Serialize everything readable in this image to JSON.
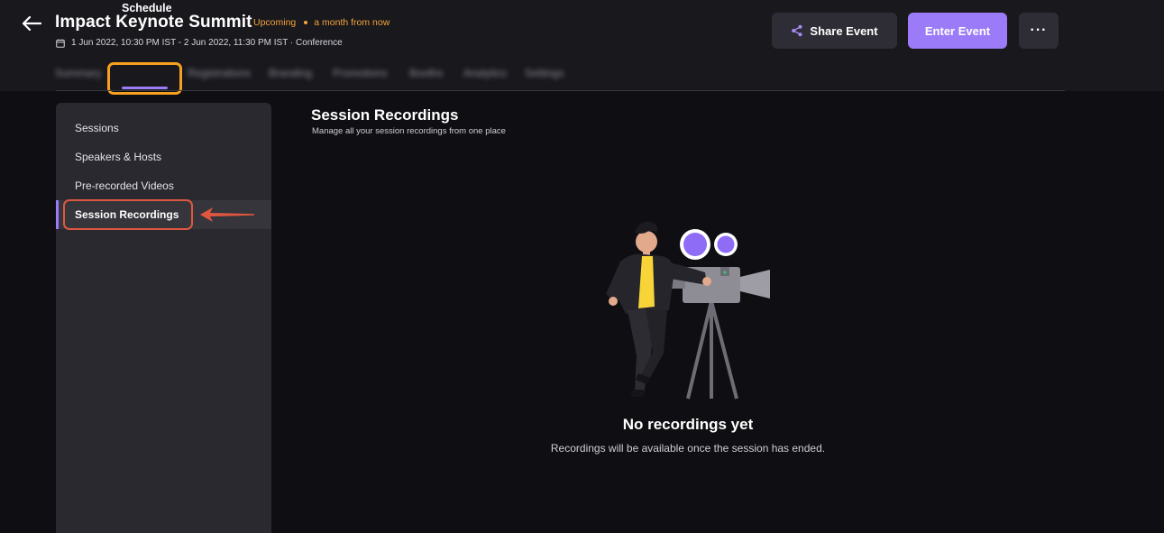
{
  "header": {
    "title": "Impact Keynote Summit",
    "status": "Upcoming",
    "relative_time": "a month from now",
    "meta": "1 Jun 2022, 10:30 PM IST - 2 Jun 2022, 11:30 PM IST · Conference",
    "share_label": "Share Event",
    "enter_label": "Enter Event",
    "more_label": "···"
  },
  "tabs": [
    {
      "label": "Summary",
      "active": false
    },
    {
      "label": "Schedule",
      "active": true
    },
    {
      "label": "Registrations",
      "active": false
    },
    {
      "label": "Branding",
      "active": false
    },
    {
      "label": "Promotions",
      "active": false
    },
    {
      "label": "Booths",
      "active": false
    },
    {
      "label": "Analytics",
      "active": false
    },
    {
      "label": "Settings",
      "active": false
    }
  ],
  "sidebar": {
    "items": [
      {
        "label": "Sessions"
      },
      {
        "label": "Speakers & Hosts"
      },
      {
        "label": "Pre-recorded Videos"
      },
      {
        "label": "Session Recordings",
        "active": true
      }
    ]
  },
  "main": {
    "title": "Session Recordings",
    "subtitle": "Manage all your session recordings from one place",
    "empty_title": "No recordings yet",
    "empty_subtitle": "Recordings will be available once the session has ended."
  },
  "colors": {
    "accent": "#9b7bf7",
    "status": "#f5a43a",
    "tab_highlight": "#f5a020",
    "callout": "#e0573f"
  },
  "icons": {
    "back": "arrow-left-icon",
    "calendar": "calendar-icon",
    "share": "share-icon"
  }
}
